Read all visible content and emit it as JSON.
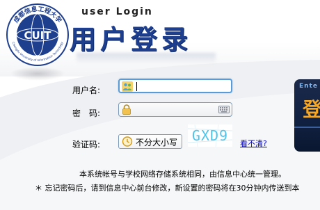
{
  "header": {
    "logo_text": "CUIT",
    "logo_ring_text_cn": "成都信息工程大学",
    "logo_ring_text_en": "Chengdu University of Information Technology",
    "title_en": "user Login",
    "title_cn": "用户登录"
  },
  "form": {
    "username_label": "用户名:",
    "username_value": "",
    "password_label": "密　码:",
    "password_value": "",
    "captcha_label": "验证码:",
    "captcha_value": "不分大小写",
    "captcha_image_text": "GXD9",
    "captcha_refresh_label": "看不清?"
  },
  "notices": {
    "line1": "本系统帐号与学校网络存储系统相同，由信息中心统一管理。",
    "line2": "＊ 忘记密码后，请到信息中心前台修改，新设置的密码将在30分钟内传送到本"
  },
  "side_panel": {
    "enter_label": "Ente",
    "big_char": "登"
  },
  "icons": {
    "username": "user-group-icon",
    "password": "lock-icon",
    "keyboard": "keyboard-icon",
    "captcha": "clock-icon"
  },
  "colors": {
    "brand": "#1e3e8e",
    "link": "#0000cc",
    "focus_border": "#5b9bd5"
  }
}
